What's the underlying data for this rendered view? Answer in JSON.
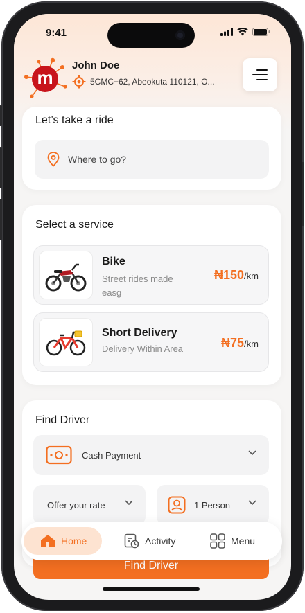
{
  "status_bar": {
    "time": "9:41"
  },
  "user": {
    "avatar_letter": "m",
    "name": "John Doe",
    "location": "5CMC+62, Abeokuta 110121, O..."
  },
  "ride": {
    "title": "Let’s take a ride",
    "placeholder": "Where to go?"
  },
  "services": {
    "title": "Select a service",
    "items": [
      {
        "name": "Bike",
        "description": "Street rides made easg",
        "price": "₦150",
        "unit": "/km"
      },
      {
        "name": "Short Delivery",
        "description": "Delivery Within Area",
        "price": "₦75",
        "unit": "/km"
      }
    ]
  },
  "find_driver": {
    "title": "Find Driver",
    "payment": "Cash Payment",
    "rate": "Offer your rate",
    "persons": "1 Person",
    "button": "Find Driver"
  },
  "tabs": [
    {
      "label": "Home",
      "active": true
    },
    {
      "label": "Activity",
      "active": false
    },
    {
      "label": "Menu",
      "active": false
    }
  ],
  "colors": {
    "accent": "#f36f21",
    "accent_light": "#fde3d1",
    "brand_red": "#c8141b",
    "card_bg": "#ffffff",
    "screen_bg": "#f6f5f4"
  }
}
